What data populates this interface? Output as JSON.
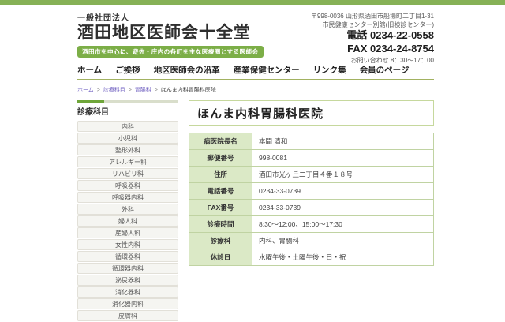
{
  "colors": {
    "brand_green": "#86b156",
    "tagline_green": "#7cae47",
    "nav_underline": "#a2b261",
    "table_header_bg": "#dbe9c6",
    "table_border": "#c0d3a2",
    "breadcrumb_link": "#7768c4"
  },
  "header": {
    "org_type": "一般社団法人",
    "org_name": "酒田地区医師会十全堂",
    "tagline": "酒田市を中心に、遊佐・庄内の各町を主な医療圏とする医師会",
    "contact": {
      "address_line1": "〒998-0036 山形県酒田市船場町二丁目1-31",
      "address_line2": "市民健康センター別館(旧検診センター)",
      "tel": "電話 0234-22-0558",
      "fax": "FAX 0234-24-8754",
      "hours": "お問い合わせ 8：30～17：00"
    }
  },
  "nav": {
    "items": [
      {
        "label": "ホーム"
      },
      {
        "label": "ご挨拶"
      },
      {
        "label": "地区医師会の沿革"
      },
      {
        "label": "産業保健センター"
      },
      {
        "label": "リンク集"
      },
      {
        "label": "会員のページ"
      }
    ]
  },
  "breadcrumb": {
    "separator": ">",
    "links": [
      {
        "label": "ホーム"
      },
      {
        "label": "診療科目"
      },
      {
        "label": "胃腸科"
      }
    ],
    "current": "ほんま内科胃腸科医院"
  },
  "sidebar": {
    "title": "診療科目",
    "items": [
      {
        "label": "内科"
      },
      {
        "label": "小児科"
      },
      {
        "label": "整形外科"
      },
      {
        "label": "アレルギー科"
      },
      {
        "label": "リハビリ科"
      },
      {
        "label": "呼吸器科"
      },
      {
        "label": "呼吸器内科"
      },
      {
        "label": "外科"
      },
      {
        "label": "婦人科"
      },
      {
        "label": "産婦人科"
      },
      {
        "label": "女性内科"
      },
      {
        "label": "循環器科"
      },
      {
        "label": "循環器内科"
      },
      {
        "label": "泌尿器科"
      },
      {
        "label": "消化器科"
      },
      {
        "label": "消化器内科"
      },
      {
        "label": "皮膚科"
      }
    ]
  },
  "main": {
    "title": "ほんま内科胃腸科医院",
    "info_table": {
      "rows": [
        {
          "label": "病医院長名",
          "value": "本間 清和"
        },
        {
          "label": "郵便番号",
          "value": "998-0081"
        },
        {
          "label": "住所",
          "value": "酒田市光ヶ丘二丁目４番１８号"
        },
        {
          "label": "電話番号",
          "value": "0234-33-0739"
        },
        {
          "label": "FAX番号",
          "value": "0234-33-0739"
        },
        {
          "label": "診療時間",
          "value": "8:30～12:00、15:00～17:30"
        },
        {
          "label": "診療科",
          "value": "内科、胃腸科"
        },
        {
          "label": "休診日",
          "value": "水曜午後・土曜午後・日・祝"
        }
      ]
    }
  }
}
